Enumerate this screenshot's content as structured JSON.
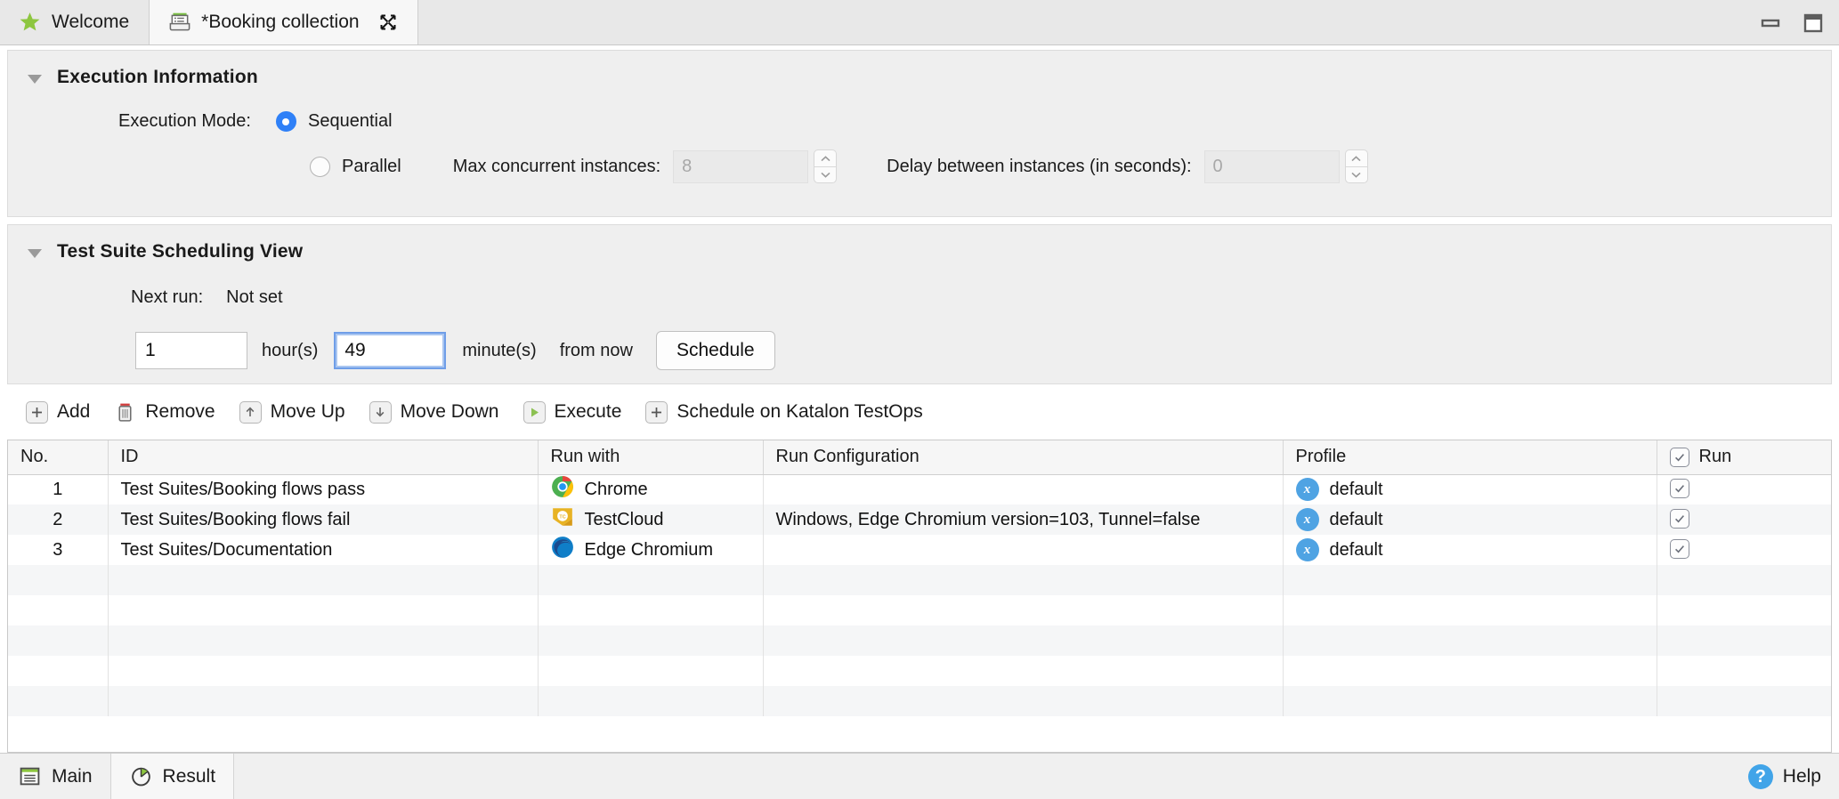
{
  "window": {
    "minimize_icon": "minimize-icon",
    "maximize_icon": "maximize-icon"
  },
  "tabs": [
    {
      "label": "Welcome",
      "icon": "star-icon",
      "active": false
    },
    {
      "label": "*Booking collection",
      "icon": "test-collection-icon",
      "active": true,
      "close_icon": "close-icon"
    }
  ],
  "execution_information": {
    "title": "Execution Information",
    "collapse_icon": "chevron-down-icon",
    "execution_mode_label": "Execution Mode:",
    "sequential_label": "Sequential",
    "parallel_label": "Parallel",
    "selected_mode": "Sequential",
    "max_concurrent_label": "Max concurrent instances:",
    "max_concurrent_value": "8",
    "delay_label": "Delay between instances (in seconds):",
    "delay_value": "0"
  },
  "scheduling": {
    "title": "Test Suite Scheduling View",
    "collapse_icon": "chevron-down-icon",
    "next_run_label": "Next run:",
    "next_run_value": "Not set",
    "hours_value": "1",
    "hours_label": "hour(s)",
    "minutes_value": "49",
    "minutes_label": "minute(s)",
    "from_now_label": "from now",
    "schedule_button": "Schedule"
  },
  "toolbar": [
    {
      "label": "Add",
      "icon": "plus-icon"
    },
    {
      "label": "Remove",
      "icon": "trash-icon"
    },
    {
      "label": "Move Up",
      "icon": "arrow-up-icon"
    },
    {
      "label": "Move Down",
      "icon": "arrow-down-icon"
    },
    {
      "label": "Execute",
      "icon": "play-icon"
    },
    {
      "label": "Schedule on Katalon TestOps",
      "icon": "plus-icon"
    }
  ],
  "table": {
    "columns": [
      "No.",
      "ID",
      "Run with",
      "Run Configuration",
      "Profile",
      "Run"
    ],
    "run_header_checkbox": true,
    "rows": [
      {
        "no": "1",
        "id": "Test Suites/Booking flows pass",
        "run_with": "Chrome",
        "run_with_icon": "chrome-icon",
        "run_configuration": "",
        "profile": "default",
        "profile_icon": "profile-x-icon",
        "run_checked": true
      },
      {
        "no": "2",
        "id": "Test Suites/Booking flows fail",
        "run_with": "TestCloud",
        "run_with_icon": "testcloud-icon",
        "run_configuration": "Windows, Edge Chromium version=103, Tunnel=false",
        "profile": "default",
        "profile_icon": "profile-x-icon",
        "run_checked": true
      },
      {
        "no": "3",
        "id": "Test Suites/Documentation",
        "run_with": "Edge Chromium",
        "run_with_icon": "edge-icon",
        "run_configuration": "",
        "profile": "default",
        "profile_icon": "profile-x-icon",
        "run_checked": true
      }
    ],
    "empty_row_count": 5
  },
  "bottom": {
    "tabs": [
      {
        "label": "Main",
        "icon": "main-list-icon",
        "active": true
      },
      {
        "label": "Result",
        "icon": "pie-chart-icon",
        "active": false
      }
    ],
    "help_label": "Help",
    "help_icon": "help-icon"
  },
  "colors": {
    "accent_blue": "#2f80f7",
    "profile_blue": "#4fa3e3",
    "help_blue": "#41a4e8",
    "play_green": "#8cc152",
    "focus_border": "#6f9ee8"
  }
}
